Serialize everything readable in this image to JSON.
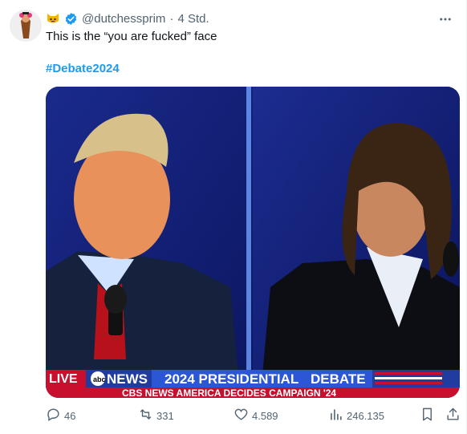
{
  "post": {
    "author_emoji": "cat-face-emoji",
    "handle": "@dutchessprim",
    "separator": "·",
    "time": "4 Std.",
    "text": "This is the “you are fucked” face",
    "hashtag": "#Debate2024"
  },
  "media": {
    "chyron_live": "LIVE",
    "chyron_network": "NEWS",
    "chyron_headline_year": "2024 PRESIDENTIAL",
    "chyron_headline_word": "DEBATE",
    "ticker": "CBS NEWS AMERICA DECIDES CAMPAIGN '24"
  },
  "actions": {
    "replies": "46",
    "reposts": "331",
    "likes": "4.589",
    "views": "246.135"
  },
  "colors": {
    "link": "#1d9bf0",
    "muted": "#536471",
    "verified": "#1d9bf0",
    "chyron_red": "#c8102e",
    "chyron_blue": "#1f3c9e"
  }
}
